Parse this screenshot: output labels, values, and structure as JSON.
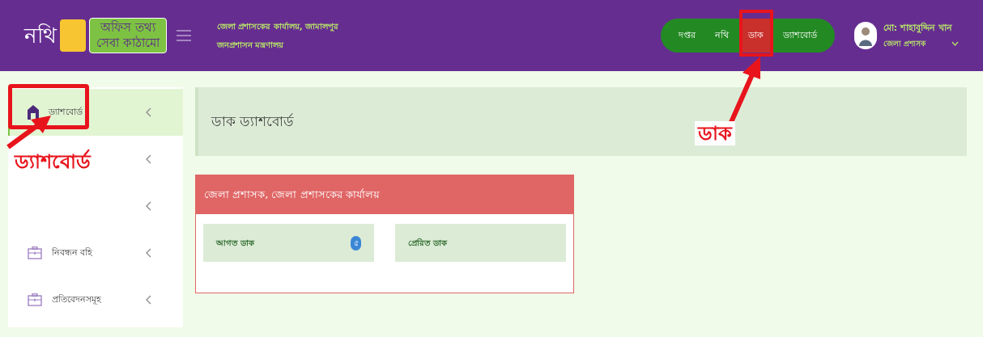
{
  "header": {
    "logo": {
      "word": "নথি",
      "line_1": "অফিস তথ্য",
      "line_2": "সেবা কাঠামো"
    },
    "office": "জেলা প্রশাসকের কার্যালয়, জামালপুর",
    "ministry": "জনপ্রশাসন মন্ত্রণালয়",
    "nav": [
      {
        "label": "দপ্তর",
        "selected": false
      },
      {
        "label": "নথি",
        "selected": false
      },
      {
        "label": "ডাক",
        "selected": true
      },
      {
        "label": "ড্যাশবোর্ড",
        "selected": false
      }
    ],
    "user": {
      "name": "মো: শাহাবুদ্দিন খান",
      "role": "জেলা প্রশাসক"
    }
  },
  "sidebar": {
    "items": [
      {
        "kind": "home",
        "label": "ড্যাশবোর্ড",
        "selected": true
      },
      {
        "kind": "hidden"
      },
      {
        "kind": "hidden"
      },
      {
        "kind": "case",
        "label": "নিবন্ধন বহি",
        "selected": false
      },
      {
        "kind": "case",
        "label": "প্রতিবেদনসমূহ",
        "selected": false
      }
    ]
  },
  "page_title": "ডাক ড্যাশবোর্ড",
  "office_card": {
    "title": "জেলা প্রশাসক, জেলা প্রশাসকের কার্যালয়",
    "tiles": [
      {
        "label": "আগত ডাক",
        "badge": "৫"
      },
      {
        "label": "প্রেরিত ডাক"
      }
    ]
  },
  "annotations": [
    {
      "kind": "nav",
      "text": "ডাক"
    },
    {
      "kind": "sidebar",
      "text": "ড্যাশবোর্ড"
    }
  ]
}
